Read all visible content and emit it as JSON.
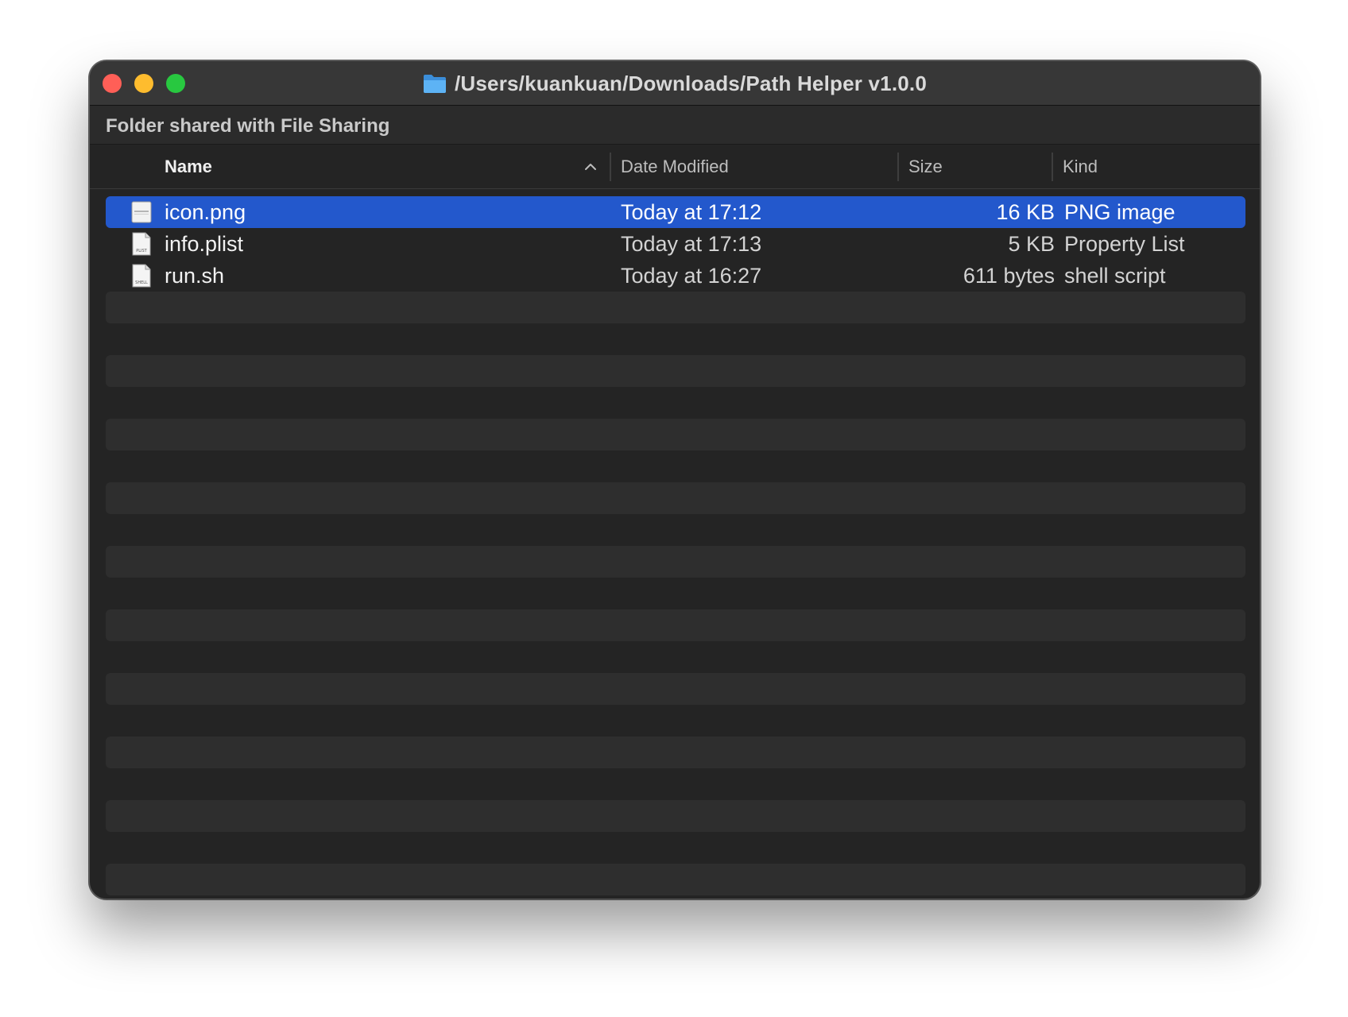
{
  "window": {
    "title": "/Users/kuankuan/Downloads/Path Helper v1.0.0",
    "folder_icon": "folder-icon"
  },
  "subheader": {
    "text": "Folder shared with File Sharing"
  },
  "columns": {
    "name": "Name",
    "date": "Date Modified",
    "size": "Size",
    "kind": "Kind",
    "sort": "name-ascending"
  },
  "files": [
    {
      "name": "icon.png",
      "date": "Today at 17:12",
      "size": "16 KB",
      "kind": "PNG image",
      "icon": "png-file-icon",
      "selected": true
    },
    {
      "name": "info.plist",
      "date": "Today at 17:13",
      "size": "5 KB",
      "kind": "Property List",
      "icon": "plist-file-icon",
      "icon_label": "PLIST"
    },
    {
      "name": "run.sh",
      "date": "Today at 16:27",
      "size": "611 bytes",
      "kind": "shell script",
      "icon": "shell-file-icon",
      "icon_label": "SHELL"
    }
  ],
  "colors": {
    "selection": "#2358cc",
    "window_bg": "#242424",
    "alt_row": "#2e2e2e",
    "close": "#ff5f57",
    "minimize": "#febc2e",
    "zoom": "#28c840"
  }
}
